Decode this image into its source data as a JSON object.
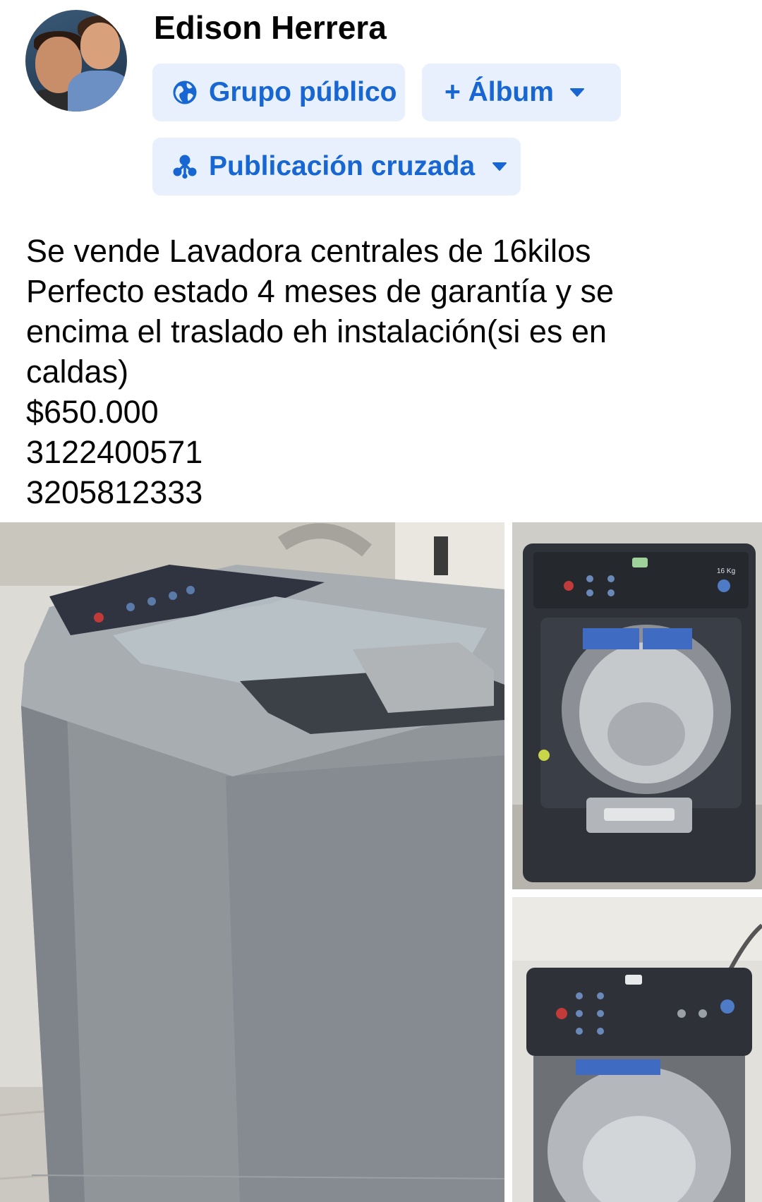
{
  "post": {
    "author": "Edison Herrera",
    "audience_label": "Grupo público",
    "album_label": "+ Álbum",
    "crosspost_label": "Publicación cruzada",
    "text_lines": [
      "Se vende Lavadora centrales de 16kilos",
      "Perfecto estado 4 meses de garantía y se",
      "encima el traslado eh instalación(si es en",
      "caldas)",
      "$650.000",
      "3122400571",
      "3205812333"
    ]
  },
  "icons": {
    "audience": "globe-icon",
    "album_caret": "caret-down-icon",
    "crosspost": "crosspost-icon",
    "crosspost_caret": "caret-down-icon"
  },
  "photos": [
    {
      "subject": "washing-machine-side-view"
    },
    {
      "subject": "washing-machine-top-open"
    },
    {
      "subject": "washing-machine-control-panel"
    }
  ],
  "washer_label": "16 Kg",
  "colors": {
    "chip_bg": "#e7f0fc",
    "chip_text": "#1766d1",
    "text": "#050505"
  }
}
